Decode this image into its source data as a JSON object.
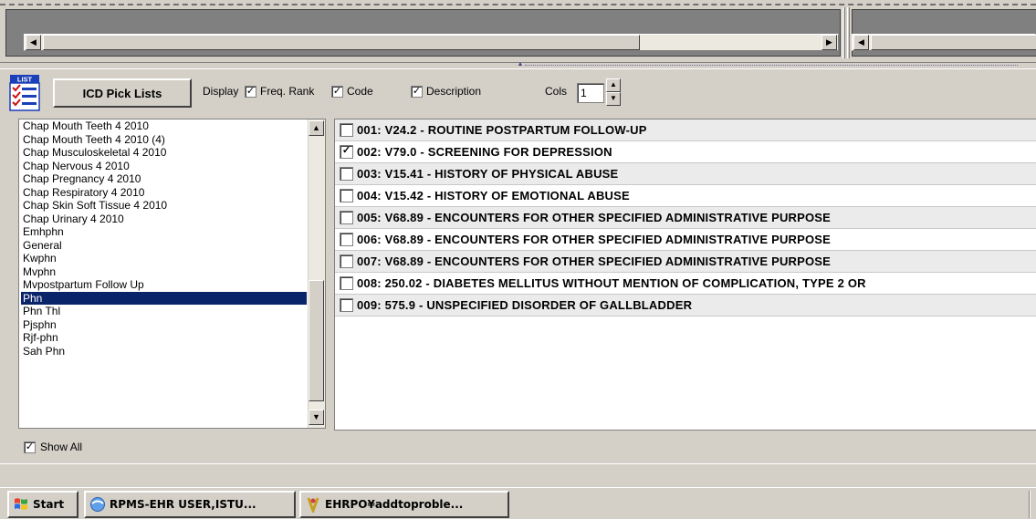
{
  "toolbar": {
    "picklist_button": "ICD Pick Lists",
    "display_label": "Display",
    "freq_rank": {
      "label": "Freq. Rank",
      "checked": true
    },
    "code": {
      "label": "Code",
      "checked": true
    },
    "description": {
      "label": "Description",
      "checked": true
    },
    "cols_label": "Cols",
    "cols_value": "1",
    "icon_text": "LIST"
  },
  "picklist": {
    "items": [
      "Chap Mouth Teeth 4 2010",
      "Chap Mouth Teeth 4 2010 (4)",
      "Chap Musculoskeletal  4 2010",
      "Chap Nervous 4 2010",
      "Chap Pregnancy  4 2010",
      "Chap Respiratory 4 2010",
      "Chap Skin Soft Tissue 4 2010",
      "Chap Urinary  4 2010",
      "Emhphn",
      "General",
      "Kwphn",
      "Mvphn",
      "Mvpostpartum Follow Up",
      "Phn",
      "Phn Thl",
      "Pjsphn",
      "Rjf-phn",
      "Sah Phn"
    ],
    "selected": "Phn"
  },
  "codes": {
    "rows": [
      {
        "text": "001: V24.2 - ROUTINE POSTPARTUM FOLLOW-UP",
        "checked": false
      },
      {
        "text": "002: V79.0 - SCREENING FOR DEPRESSION",
        "checked": true
      },
      {
        "text": "003: V15.41 - HISTORY OF PHYSICAL ABUSE",
        "checked": false
      },
      {
        "text": "004: V15.42 - HISTORY OF EMOTIONAL ABUSE",
        "checked": false
      },
      {
        "text": "005: V68.89 - ENCOUNTERS FOR OTHER SPECIFIED ADMINISTRATIVE PURPOSE",
        "checked": false
      },
      {
        "text": "006: V68.89 - ENCOUNTERS FOR OTHER SPECIFIED ADMINISTRATIVE PURPOSE",
        "checked": false
      },
      {
        "text": "007: V68.89 - ENCOUNTERS FOR OTHER SPECIFIED ADMINISTRATIVE PURPOSE",
        "checked": false
      },
      {
        "text": "008: 250.02 - DIABETES MELLITUS WITHOUT MENTION OF COMPLICATION, TYPE 2 OR",
        "checked": false
      },
      {
        "text": "009: 575.9 - UNSPECIFIED DISORDER OF GALLBLADDER",
        "checked": false
      }
    ]
  },
  "show_all": {
    "label": "Show All",
    "checked": true
  },
  "taskbar": {
    "start": "Start",
    "tasks": [
      {
        "label": "RPMS-EHR USER,ISTU...",
        "icon": "browser-icon"
      },
      {
        "label": "EHRPO¥addtoproble...",
        "icon": "app-icon"
      }
    ]
  },
  "colors": {
    "selection": "#0a246a",
    "window_bg": "#d4d0c8",
    "pane_dark": "#808080"
  }
}
